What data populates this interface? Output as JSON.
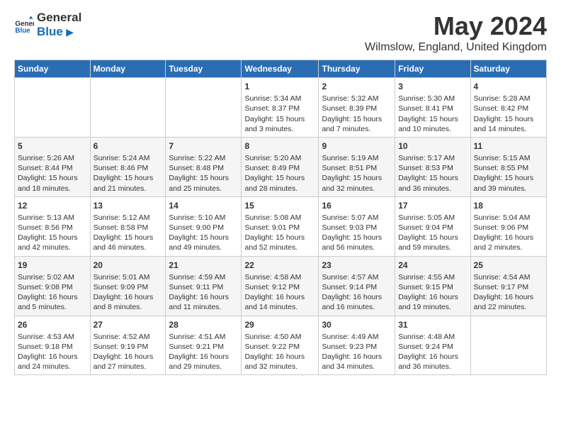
{
  "header": {
    "logo_general": "General",
    "logo_blue": "Blue",
    "title": "May 2024",
    "subtitle": "Wilmslow, England, United Kingdom"
  },
  "weekdays": [
    "Sunday",
    "Monday",
    "Tuesday",
    "Wednesday",
    "Thursday",
    "Friday",
    "Saturday"
  ],
  "weeks": [
    [
      {
        "day": null,
        "info": null
      },
      {
        "day": null,
        "info": null
      },
      {
        "day": null,
        "info": null
      },
      {
        "day": "1",
        "info": "Sunrise: 5:34 AM\nSunset: 8:37 PM\nDaylight: 15 hours\nand 3 minutes."
      },
      {
        "day": "2",
        "info": "Sunrise: 5:32 AM\nSunset: 8:39 PM\nDaylight: 15 hours\nand 7 minutes."
      },
      {
        "day": "3",
        "info": "Sunrise: 5:30 AM\nSunset: 8:41 PM\nDaylight: 15 hours\nand 10 minutes."
      },
      {
        "day": "4",
        "info": "Sunrise: 5:28 AM\nSunset: 8:42 PM\nDaylight: 15 hours\nand 14 minutes."
      }
    ],
    [
      {
        "day": "5",
        "info": "Sunrise: 5:26 AM\nSunset: 8:44 PM\nDaylight: 15 hours\nand 18 minutes."
      },
      {
        "day": "6",
        "info": "Sunrise: 5:24 AM\nSunset: 8:46 PM\nDaylight: 15 hours\nand 21 minutes."
      },
      {
        "day": "7",
        "info": "Sunrise: 5:22 AM\nSunset: 8:48 PM\nDaylight: 15 hours\nand 25 minutes."
      },
      {
        "day": "8",
        "info": "Sunrise: 5:20 AM\nSunset: 8:49 PM\nDaylight: 15 hours\nand 28 minutes."
      },
      {
        "day": "9",
        "info": "Sunrise: 5:19 AM\nSunset: 8:51 PM\nDaylight: 15 hours\nand 32 minutes."
      },
      {
        "day": "10",
        "info": "Sunrise: 5:17 AM\nSunset: 8:53 PM\nDaylight: 15 hours\nand 36 minutes."
      },
      {
        "day": "11",
        "info": "Sunrise: 5:15 AM\nSunset: 8:55 PM\nDaylight: 15 hours\nand 39 minutes."
      }
    ],
    [
      {
        "day": "12",
        "info": "Sunrise: 5:13 AM\nSunset: 8:56 PM\nDaylight: 15 hours\nand 42 minutes."
      },
      {
        "day": "13",
        "info": "Sunrise: 5:12 AM\nSunset: 8:58 PM\nDaylight: 15 hours\nand 46 minutes."
      },
      {
        "day": "14",
        "info": "Sunrise: 5:10 AM\nSunset: 9:00 PM\nDaylight: 15 hours\nand 49 minutes."
      },
      {
        "day": "15",
        "info": "Sunrise: 5:08 AM\nSunset: 9:01 PM\nDaylight: 15 hours\nand 52 minutes."
      },
      {
        "day": "16",
        "info": "Sunrise: 5:07 AM\nSunset: 9:03 PM\nDaylight: 15 hours\nand 56 minutes."
      },
      {
        "day": "17",
        "info": "Sunrise: 5:05 AM\nSunset: 9:04 PM\nDaylight: 15 hours\nand 59 minutes."
      },
      {
        "day": "18",
        "info": "Sunrise: 5:04 AM\nSunset: 9:06 PM\nDaylight: 16 hours\nand 2 minutes."
      }
    ],
    [
      {
        "day": "19",
        "info": "Sunrise: 5:02 AM\nSunset: 9:08 PM\nDaylight: 16 hours\nand 5 minutes."
      },
      {
        "day": "20",
        "info": "Sunrise: 5:01 AM\nSunset: 9:09 PM\nDaylight: 16 hours\nand 8 minutes."
      },
      {
        "day": "21",
        "info": "Sunrise: 4:59 AM\nSunset: 9:11 PM\nDaylight: 16 hours\nand 11 minutes."
      },
      {
        "day": "22",
        "info": "Sunrise: 4:58 AM\nSunset: 9:12 PM\nDaylight: 16 hours\nand 14 minutes."
      },
      {
        "day": "23",
        "info": "Sunrise: 4:57 AM\nSunset: 9:14 PM\nDaylight: 16 hours\nand 16 minutes."
      },
      {
        "day": "24",
        "info": "Sunrise: 4:55 AM\nSunset: 9:15 PM\nDaylight: 16 hours\nand 19 minutes."
      },
      {
        "day": "25",
        "info": "Sunrise: 4:54 AM\nSunset: 9:17 PM\nDaylight: 16 hours\nand 22 minutes."
      }
    ],
    [
      {
        "day": "26",
        "info": "Sunrise: 4:53 AM\nSunset: 9:18 PM\nDaylight: 16 hours\nand 24 minutes."
      },
      {
        "day": "27",
        "info": "Sunrise: 4:52 AM\nSunset: 9:19 PM\nDaylight: 16 hours\nand 27 minutes."
      },
      {
        "day": "28",
        "info": "Sunrise: 4:51 AM\nSunset: 9:21 PM\nDaylight: 16 hours\nand 29 minutes."
      },
      {
        "day": "29",
        "info": "Sunrise: 4:50 AM\nSunset: 9:22 PM\nDaylight: 16 hours\nand 32 minutes."
      },
      {
        "day": "30",
        "info": "Sunrise: 4:49 AM\nSunset: 9:23 PM\nDaylight: 16 hours\nand 34 minutes."
      },
      {
        "day": "31",
        "info": "Sunrise: 4:48 AM\nSunset: 9:24 PM\nDaylight: 16 hours\nand 36 minutes."
      },
      {
        "day": null,
        "info": null
      }
    ]
  ]
}
